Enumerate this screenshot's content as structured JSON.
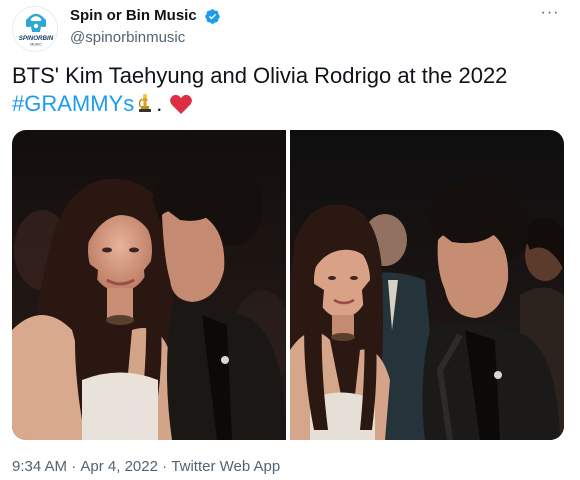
{
  "account": {
    "display_name": "Spin or Bin Music",
    "handle": "@spinorbinmusic",
    "avatar_text": "SPINORBIN",
    "avatar_subtext": "MUSIC",
    "verified_icon": "verified-badge-icon"
  },
  "tweet": {
    "text_main": "BTS' Kim Taehyung and Olivia Rodrigo at the 2022",
    "hashtag": "#GRAMMYs",
    "separator": ".",
    "emojis": [
      "trophy-icon",
      "heart-icon"
    ]
  },
  "media": {
    "photos": [
      {
        "name": "photo-1",
        "description_icon": "photo-icon"
      },
      {
        "name": "photo-2",
        "description_icon": "photo-icon"
      }
    ]
  },
  "footer": {
    "time": "9:34 AM",
    "dot1": "·",
    "date": "Apr 4, 2022",
    "dot2": "·",
    "source": "Twitter Web App"
  },
  "colors": {
    "link": "#1d9bf0",
    "text": "#0f1419",
    "secondary": "#536471",
    "heart": "#f91880"
  }
}
